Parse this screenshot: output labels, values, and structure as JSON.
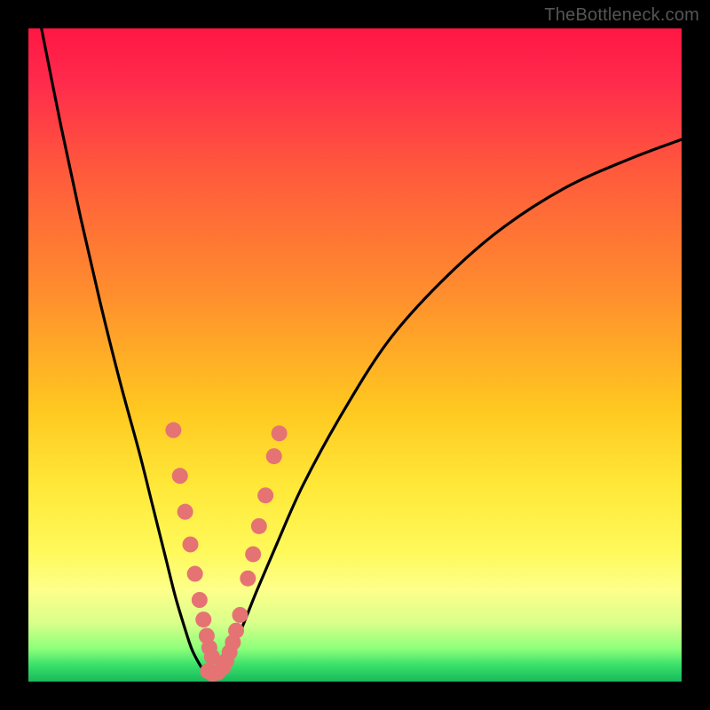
{
  "watermark": "TheBottleneck.com",
  "colors": {
    "gradient_stops": [
      {
        "offset": 0,
        "color": "#ff1744"
      },
      {
        "offset": 0.08,
        "color": "#ff2a4c"
      },
      {
        "offset": 0.22,
        "color": "#ff5a3c"
      },
      {
        "offset": 0.4,
        "color": "#ff8c2e"
      },
      {
        "offset": 0.58,
        "color": "#ffc720"
      },
      {
        "offset": 0.7,
        "color": "#ffe838"
      },
      {
        "offset": 0.8,
        "color": "#fff95a"
      },
      {
        "offset": 0.86,
        "color": "#fdff8a"
      },
      {
        "offset": 0.91,
        "color": "#d9ff8a"
      },
      {
        "offset": 0.95,
        "color": "#8cff7a"
      },
      {
        "offset": 0.975,
        "color": "#39e06a"
      },
      {
        "offset": 1.0,
        "color": "#18b85c"
      }
    ],
    "curve": "#000000",
    "marker": "#e57373",
    "background_frame": "#000000"
  },
  "chart_data": {
    "type": "line",
    "title": "",
    "xlabel": "",
    "ylabel": "",
    "xlim": [
      0,
      100
    ],
    "ylim": [
      0,
      100
    ],
    "grid": false,
    "legend": false,
    "series": [
      {
        "name": "bottleneck-curve-left",
        "x": [
          2,
          5,
          8,
          11,
          14,
          17,
          19,
          21,
          22.5,
          24,
          25,
          26,
          27,
          28
        ],
        "y": [
          100,
          85,
          71,
          58,
          46,
          35,
          27,
          19,
          13,
          8,
          5,
          3,
          1.5,
          0.8
        ]
      },
      {
        "name": "bottleneck-curve-right",
        "x": [
          28,
          29,
          30,
          31.5,
          33,
          35,
          38,
          42,
          48,
          55,
          63,
          72,
          82,
          92,
          100
        ],
        "y": [
          0.8,
          1.5,
          3,
          5.5,
          9,
          14,
          21,
          30,
          41,
          52,
          61,
          69,
          75.5,
          80,
          83
        ]
      }
    ],
    "markers": {
      "name": "highlighted-points",
      "color": "#e57373",
      "radius_px": 9,
      "points": [
        {
          "x": 22.2,
          "y": 38.5
        },
        {
          "x": 23.2,
          "y": 31.5
        },
        {
          "x": 24.0,
          "y": 26.0
        },
        {
          "x": 24.8,
          "y": 21.0
        },
        {
          "x": 25.5,
          "y": 16.5
        },
        {
          "x": 26.2,
          "y": 12.5
        },
        {
          "x": 26.8,
          "y": 9.5
        },
        {
          "x": 27.3,
          "y": 7.0
        },
        {
          "x": 27.7,
          "y": 5.2
        },
        {
          "x": 28.1,
          "y": 3.8
        },
        {
          "x": 27.5,
          "y": 1.6
        },
        {
          "x": 28.2,
          "y": 1.2
        },
        {
          "x": 29.0,
          "y": 1.4
        },
        {
          "x": 29.8,
          "y": 2.2
        },
        {
          "x": 30.3,
          "y": 3.2
        },
        {
          "x": 30.8,
          "y": 4.5
        },
        {
          "x": 31.3,
          "y": 6.0
        },
        {
          "x": 31.8,
          "y": 7.8
        },
        {
          "x": 32.4,
          "y": 10.2
        },
        {
          "x": 33.6,
          "y": 15.8
        },
        {
          "x": 34.4,
          "y": 19.5
        },
        {
          "x": 35.3,
          "y": 23.8
        },
        {
          "x": 36.3,
          "y": 28.5
        },
        {
          "x": 37.6,
          "y": 34.5
        },
        {
          "x": 38.4,
          "y": 38.0
        }
      ]
    }
  }
}
